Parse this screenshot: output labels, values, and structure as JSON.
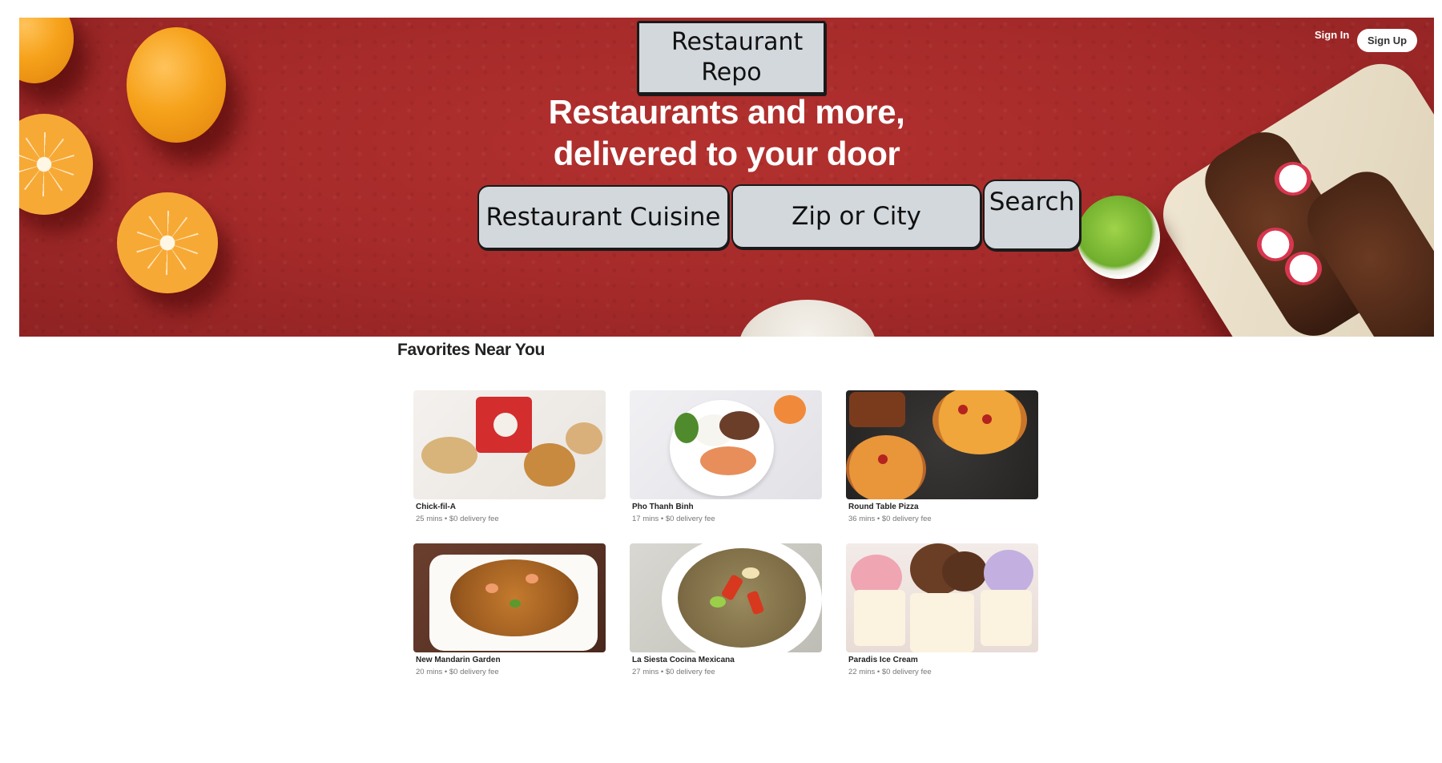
{
  "header": {
    "logo_text": "Restaurant Repo",
    "headline": "Restaurants and more, delivered to your door",
    "sign_in": "Sign In",
    "sign_up": "Sign Up"
  },
  "search": {
    "cuisine_placeholder": "Restaurant Cuisine",
    "location_placeholder": "Zip or City",
    "button_label": "Search"
  },
  "favorites": {
    "title": "Favorites Near You",
    "restaurants": [
      {
        "name": "Chick-fil-A",
        "meta": "25 mins • $0 delivery fee"
      },
      {
        "name": "Pho Thanh Binh",
        "meta": "17 mins • $0 delivery fee"
      },
      {
        "name": "Round Table Pizza",
        "meta": "36 mins • $0 delivery fee"
      },
      {
        "name": "New Mandarin Garden",
        "meta": "20 mins • $0 delivery fee"
      },
      {
        "name": "La Siesta Cocina Mexicana",
        "meta": "27 mins • $0 delivery fee"
      },
      {
        "name": "Paradis Ice Cream",
        "meta": "22 mins • $0 delivery fee"
      }
    ]
  },
  "colors": {
    "hero_red": "#a42a29",
    "sketch_fill": "#d3d8dd"
  }
}
